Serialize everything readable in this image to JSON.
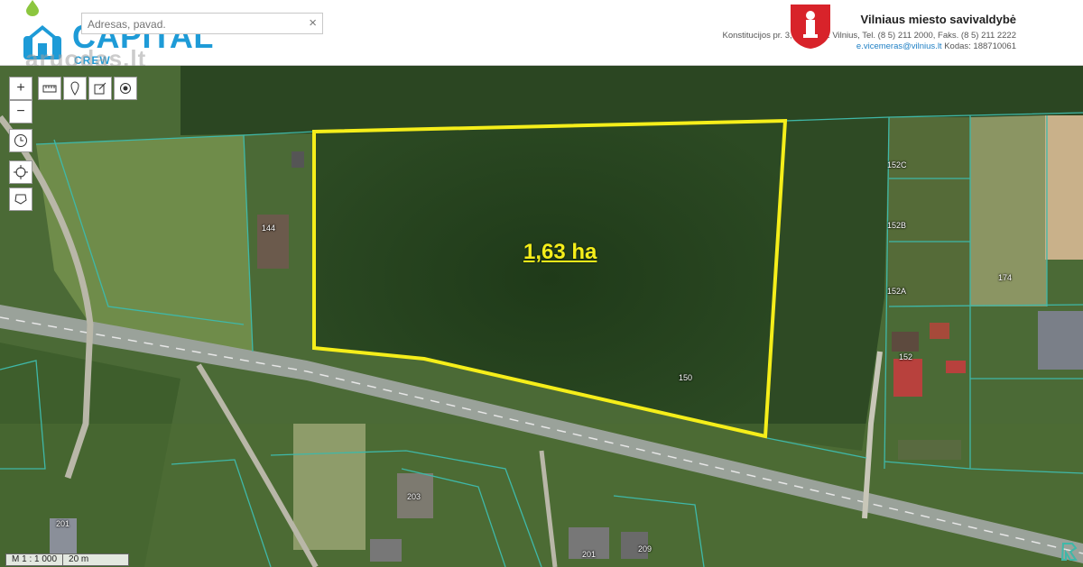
{
  "search": {
    "placeholder": "Adresas, pavad."
  },
  "logo": {
    "name": "CAPITAL",
    "sub": "CREW",
    "watermark": "aruodas.lt"
  },
  "municipality": {
    "title": "Vilniaus miesto savivaldybė",
    "address": "Konstitucijos pr. 3, LT-09601 Vilnius, Tel. (8 5) 211 2000, Faks. (8 5) 211 2222",
    "email": "e.vicemeras@vilnius.lt",
    "code": "Kodas: 188710061"
  },
  "map": {
    "area_label": "1,63 ha",
    "parcel_numbers": [
      "152C",
      "152B",
      "152A",
      "174",
      "152",
      "150",
      "144",
      "203",
      "209",
      "201",
      "201"
    ],
    "scale": {
      "ratio": "M 1 : 1 000",
      "distance": "20 m"
    }
  },
  "colors": {
    "brand": "#1e9bd7",
    "highlight": "#f5ee1a",
    "parcel_line": "#3fb8a8"
  }
}
